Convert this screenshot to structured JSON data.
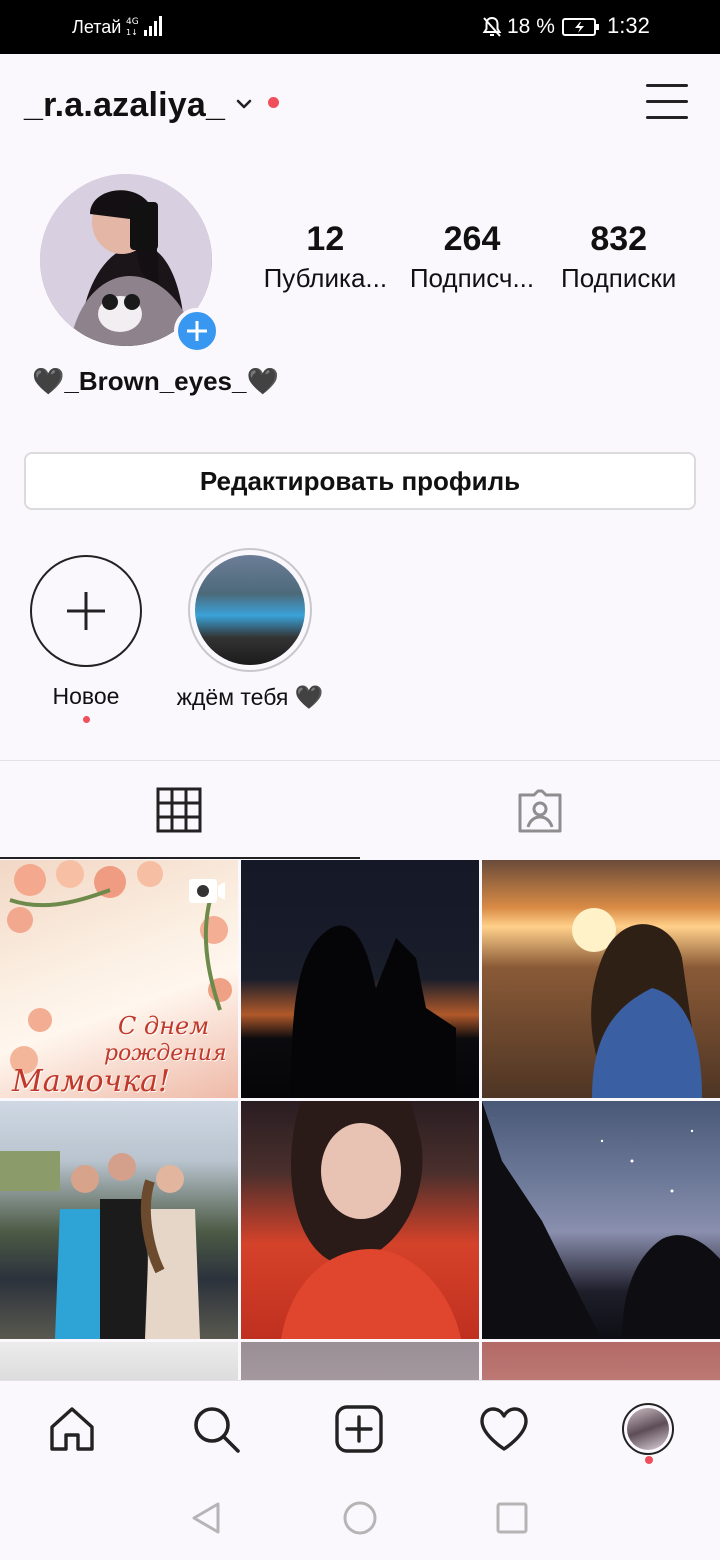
{
  "status_bar": {
    "carrier": "Летай",
    "network": "4G",
    "battery": "18 %",
    "time": "1:32"
  },
  "header": {
    "username": "_r.a.azaliya_",
    "icons": [
      "chevron-down-icon",
      "notification-dot",
      "hamburger-menu-icon"
    ]
  },
  "profile": {
    "stats": [
      {
        "value": "12",
        "label": "Публика..."
      },
      {
        "value": "264",
        "label": "Подписч..."
      },
      {
        "value": "832",
        "label": "Подписки"
      }
    ],
    "display_name": "🖤_Brown_eyes_🖤",
    "edit_button": "Редактировать профиль"
  },
  "highlights": [
    {
      "label": "Новое",
      "icon": "plus-icon"
    },
    {
      "label": "ждём тебя 🖤"
    }
  ],
  "tabs": [
    {
      "name": "grid",
      "icon": "grid-icon",
      "active": true
    },
    {
      "name": "tagged",
      "icon": "tagged-person-icon",
      "active": false
    }
  ],
  "posts": {
    "first_post_text": [
      "С днем",
      "рождения",
      "Мамочка!"
    ]
  },
  "bottom_nav": [
    "home-icon",
    "search-icon",
    "add-post-icon",
    "heart-icon",
    "profile-avatar"
  ],
  "colors": {
    "accent_blue": "#3897f0",
    "notification_red": "#ef4f5a",
    "background": "#fbf8fd"
  }
}
